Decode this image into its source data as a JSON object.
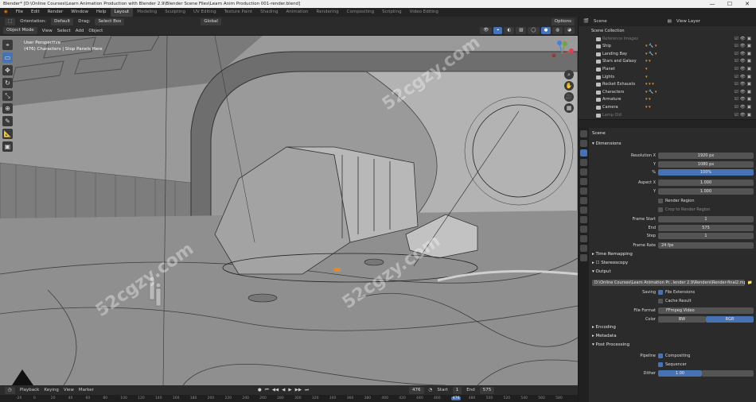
{
  "window": {
    "title": "Blender* [D:\\Online Courses\\Learn Animation Production with Blender 2.9\\Blender Scene Files\\Learn Anim Production 001-render.blend]",
    "controls": [
      "—",
      "☐",
      "✕"
    ]
  },
  "menu": {
    "items": [
      "File",
      "Edit",
      "Render",
      "Window",
      "Help"
    ],
    "workspaces": [
      "Layout",
      "Modeling",
      "Sculpting",
      "UV Editing",
      "Texture Paint",
      "Shading",
      "Animation",
      "Rendering",
      "Compositing",
      "Scripting",
      "Video Editing"
    ],
    "active_workspace": "Layout"
  },
  "viewport": {
    "orientation_label": "Orientation:",
    "orientation_value": "Default",
    "drag_label": "Drag:",
    "drag_value": "Select Box",
    "transform_orientation": "Global",
    "options": "Options",
    "mode": "Object Mode",
    "menus": [
      "View",
      "Select",
      "Add",
      "Object"
    ],
    "info_line1": "User Perspective",
    "info_line2": "(476) Characters | Stop Panels Here"
  },
  "toolbar": {
    "icons": [
      "cursor-icon",
      "select-box-icon",
      "move-icon",
      "rotate-icon",
      "scale-icon",
      "transform-icon",
      "annotate-icon",
      "measure-icon",
      "add-cube-icon"
    ],
    "glyphs": [
      "⌖",
      "▭",
      "✥",
      "↻",
      "⤡",
      "⊕",
      "✎",
      "📐",
      "▣"
    ]
  },
  "nav_buttons": [
    "⌕",
    "✋",
    "🎥",
    "▦"
  ],
  "timeline": {
    "menus": [
      "Playback",
      "Keying",
      "View",
      "Marker"
    ],
    "current_frame": "476",
    "start_label": "Start",
    "start_value": "1",
    "end_label": "End",
    "end_value": "575",
    "ruler_ticks": [
      "-20",
      "0",
      "20",
      "40",
      "60",
      "80",
      "100",
      "120",
      "140",
      "160",
      "180",
      "200",
      "220",
      "240",
      "260",
      "280",
      "300",
      "320",
      "340",
      "360",
      "380",
      "400",
      "420",
      "440",
      "460",
      "476",
      "480",
      "500",
      "520",
      "540",
      "560",
      "580"
    ]
  },
  "right_header": {
    "scene": "Scene",
    "view_layer": "View Layer"
  },
  "outliner": {
    "rows": [
      {
        "name": "Scene Collection",
        "tags": ""
      },
      {
        "name": "Reference Images",
        "tags": ""
      },
      {
        "name": "Ship",
        "tags": "▾ 🔧 ▾"
      },
      {
        "name": "Landing Bay",
        "tags": "▾ 🔧 ▾"
      },
      {
        "name": "Stars and Galaxy",
        "tags": "▾ ▾"
      },
      {
        "name": "Planet",
        "tags": "▾"
      },
      {
        "name": "Lights",
        "tags": "▾"
      },
      {
        "name": "Rocket Exhausts",
        "tags": "▾ ▾ ▾"
      },
      {
        "name": "Characters",
        "tags": "▾ 🔧 ▾"
      },
      {
        "name": "Armature",
        "tags": "▾ ▾"
      },
      {
        "name": "Camera",
        "tags": "▾ ▾"
      },
      {
        "name": "Lamp Old",
        "tags": ""
      }
    ]
  },
  "properties": {
    "search_placeholder": "",
    "context": "Scene",
    "sections": {
      "dimensions": "Dimensions",
      "time_remapping": "Time Remapping",
      "stereoscopy": "Stereoscopy",
      "output": "Output",
      "encoding": "Encoding",
      "metadata": "Metadata",
      "post_processing": "Post Processing"
    },
    "resolution_x_label": "Resolution X",
    "resolution_x": "1920 px",
    "resolution_y_label": "Y",
    "resolution_y": "1080 px",
    "resolution_pct_label": "%",
    "resolution_pct": "100%",
    "aspect_x_label": "Aspect X",
    "aspect_x": "1.000",
    "aspect_y_label": "Y",
    "aspect_y": "1.000",
    "render_region": "Render Region",
    "crop_region": "Crop to Render Region",
    "frame_start_label": "Frame Start",
    "frame_start": "1",
    "frame_end_label": "End",
    "frame_end": "575",
    "frame_step_label": "Step",
    "frame_step": "1",
    "frame_rate_label": "Frame Rate",
    "frame_rate": "24 fps",
    "output_path": "D:\\Online Courses\\Learn Animation Pr...lender 2.9\\Renders\\Render-final2.mp4",
    "saving_label": "Saving",
    "file_extensions": "File Extensions",
    "cache_result": "Cache Result",
    "file_format_label": "File Format",
    "file_format": "FFmpeg Video",
    "color_label": "Color",
    "color_bw": "BW",
    "color_rgb": "RGB",
    "pipeline_label": "Pipeline",
    "compositing": "Compositing",
    "sequencer": "Sequencer",
    "dither_label": "Dither",
    "dither_value": "1.00"
  },
  "watermark": "52cgzy.com",
  "colors": {
    "accent": "#4772b3",
    "bg": "#2b2b2b",
    "viewport_gray": "#8a8a8a",
    "orange": "#e09a4f"
  }
}
